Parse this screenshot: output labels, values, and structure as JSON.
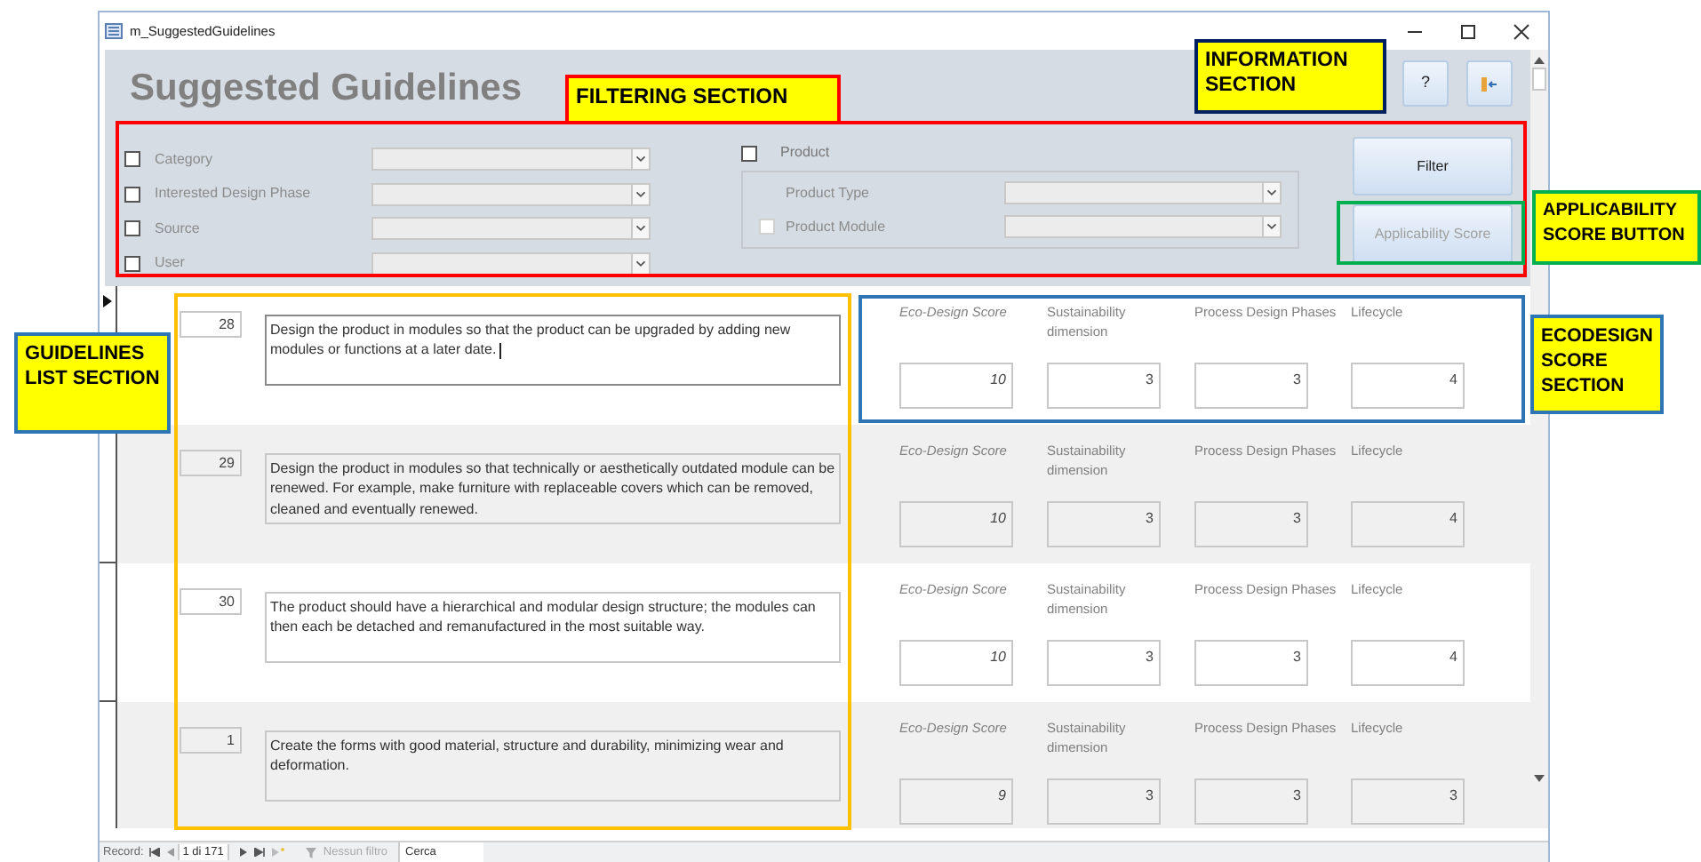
{
  "window": {
    "title": "m_SuggestedGuidelines"
  },
  "header": {
    "title": "Suggested Guidelines",
    "buttons": [
      {
        "kind": "help",
        "label": "?"
      },
      {
        "kind": "exit"
      }
    ]
  },
  "filters": {
    "left": [
      {
        "label": "Category",
        "checked": false
      },
      {
        "label": "Interested Design Phase",
        "checked": false
      },
      {
        "label": "Source",
        "checked": false
      },
      {
        "label": "User",
        "checked": false
      }
    ],
    "product": {
      "label": "Product",
      "checked": false,
      "fields": [
        {
          "kind": "plain",
          "label": "Product Type"
        },
        {
          "kind": "checkbox",
          "label": "Product Module",
          "checked": false
        }
      ]
    },
    "buttons": [
      {
        "label": "Filter",
        "disabled": false
      },
      {
        "label": "Applicability Score",
        "disabled": true
      }
    ]
  },
  "records": [
    {
      "id": "28",
      "current": true,
      "focused": true,
      "text": "Design the product in modules so that the product can be upgraded by adding new modules or functions at a later date.",
      "scores": [
        {
          "kind": "total",
          "label": "Eco-Design Score",
          "value": "10"
        },
        {
          "kind": "part",
          "label": "Sustainability dimension",
          "value": "3"
        },
        {
          "kind": "part",
          "label": "Process Design Phases",
          "value": "3"
        },
        {
          "kind": "part",
          "label": "Lifecycle",
          "value": "4"
        }
      ]
    },
    {
      "id": "29",
      "current": false,
      "focused": false,
      "text": "Design the product in modules so that technically or aesthetically outdated module can be renewed. For example, make furniture with replaceable covers which can be removed, cleaned and eventually renewed.",
      "scores": [
        {
          "kind": "total",
          "label": "Eco-Design Score",
          "value": "10"
        },
        {
          "kind": "part",
          "label": "Sustainability dimension",
          "value": "3"
        },
        {
          "kind": "part",
          "label": "Process Design Phases",
          "value": "3"
        },
        {
          "kind": "part",
          "label": "Lifecycle",
          "value": "4"
        }
      ]
    },
    {
      "id": "30",
      "current": false,
      "focused": false,
      "text": "The product should have a hierarchical and modular design structure; the modules can then each be detached and remanufactured in the most suitable way.",
      "scores": [
        {
          "kind": "total",
          "label": "Eco-Design Score",
          "value": "10"
        },
        {
          "kind": "part",
          "label": "Sustainability dimension",
          "value": "3"
        },
        {
          "kind": "part",
          "label": "Process Design Phases",
          "value": "3"
        },
        {
          "kind": "part",
          "label": "Lifecycle",
          "value": "4"
        }
      ]
    },
    {
      "id": "1",
      "current": false,
      "focused": false,
      "text": "Create the forms with good material, structure and durability, minimizing wear and deformation.",
      "scores": [
        {
          "kind": "total",
          "label": "Eco-Design Score",
          "value": "9"
        },
        {
          "kind": "part",
          "label": "Sustainability dimension",
          "value": "3"
        },
        {
          "kind": "part",
          "label": "Process Design Phases",
          "value": "3"
        },
        {
          "kind": "part",
          "label": "Lifecycle",
          "value": "3"
        }
      ]
    }
  ],
  "status_bar": {
    "label": "Record:",
    "position": "1 di 171",
    "filter": "Nessun filtro",
    "search": "Cerca"
  },
  "annotations": [
    {
      "text": "FILTERING SECTION",
      "color": "#ff0000"
    },
    {
      "text": "INFORMATION SECTION",
      "color": "#002060"
    },
    {
      "text": "APPLICABILITY SCORE BUTTON",
      "color": "#00b050"
    },
    {
      "text": "GUIDELINES LIST SECTION",
      "color": "#2e75b6"
    },
    {
      "text": "ECODESIGN SCORE SECTION",
      "color": "#2e75b6"
    }
  ],
  "frames": [
    {
      "kind": "filtering",
      "color": "#ff0000"
    },
    {
      "kind": "applicability",
      "color": "#00b050"
    },
    {
      "kind": "guidelines",
      "color": "#ffc000"
    },
    {
      "kind": "ecodesign",
      "color": "#2e75b6"
    }
  ]
}
